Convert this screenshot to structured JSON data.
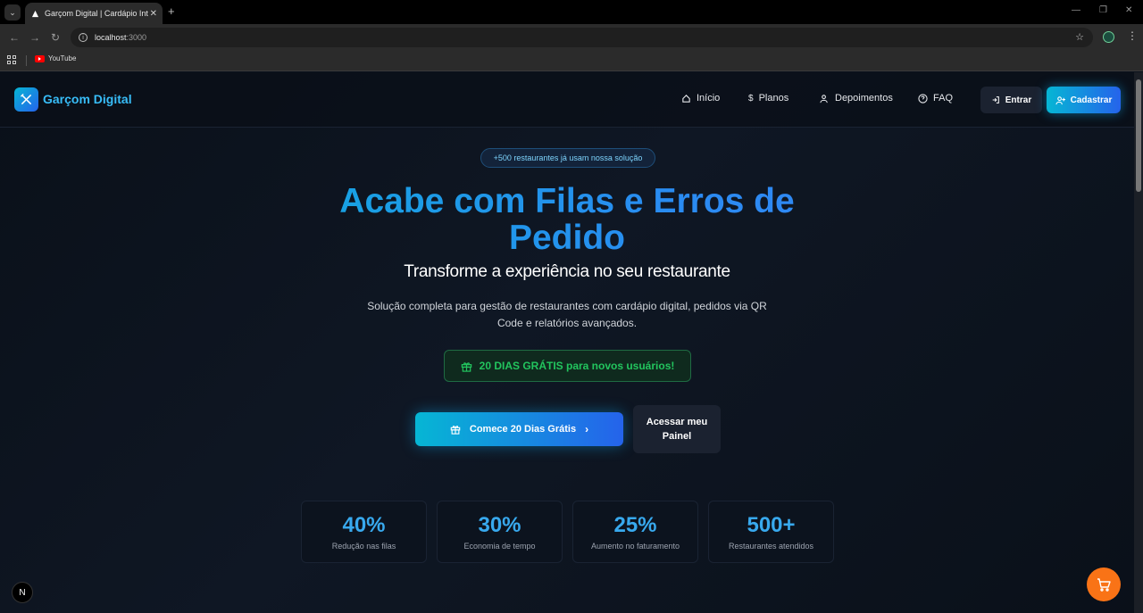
{
  "browser": {
    "tab_title": "Garçom Digital | Cardápio Inte",
    "url_host": "localhost",
    "url_port": ":3000",
    "bookmarks": [
      {
        "label": "YouTube"
      }
    ]
  },
  "site": {
    "brand": "Garçom Digital",
    "nav": [
      {
        "label": "Início",
        "icon": "home-icon"
      },
      {
        "label": "Planos",
        "icon": "dollar-icon"
      },
      {
        "label": "Depoimentos",
        "icon": "users-icon"
      },
      {
        "label": "FAQ",
        "icon": "help-circle-icon"
      }
    ],
    "login_label": "Entrar",
    "signup_label": "Cadastrar"
  },
  "hero": {
    "badge": "+500 restaurantes já usam nossa solução",
    "title_line1": "Acabe com Filas e Erros de",
    "title_line2": "Pedido",
    "subtitle": "Transforme a experiência no seu restaurante",
    "description": "Solução completa para gestão de restaurantes com cardápio digital, pedidos via QR Code e relatórios avançados.",
    "promo": "20 DIAS GRÁTIS para novos usuários!",
    "cta_primary": "Comece 20 Dias Grátis",
    "cta_secondary": "Acessar meu Painel"
  },
  "stats": [
    {
      "value": "40%",
      "label": "Redução nas filas"
    },
    {
      "value": "30%",
      "label": "Economia de tempo"
    },
    {
      "value": "25%",
      "label": "Aumento no faturamento"
    },
    {
      "value": "500+",
      "label": "Restaurantes atendidos"
    }
  ],
  "colors": {
    "accent_cyan": "#06b6d4",
    "accent_blue": "#2563eb",
    "promo_green": "#22c55e",
    "cart_orange": "#f97316",
    "background": "#0b111c"
  }
}
